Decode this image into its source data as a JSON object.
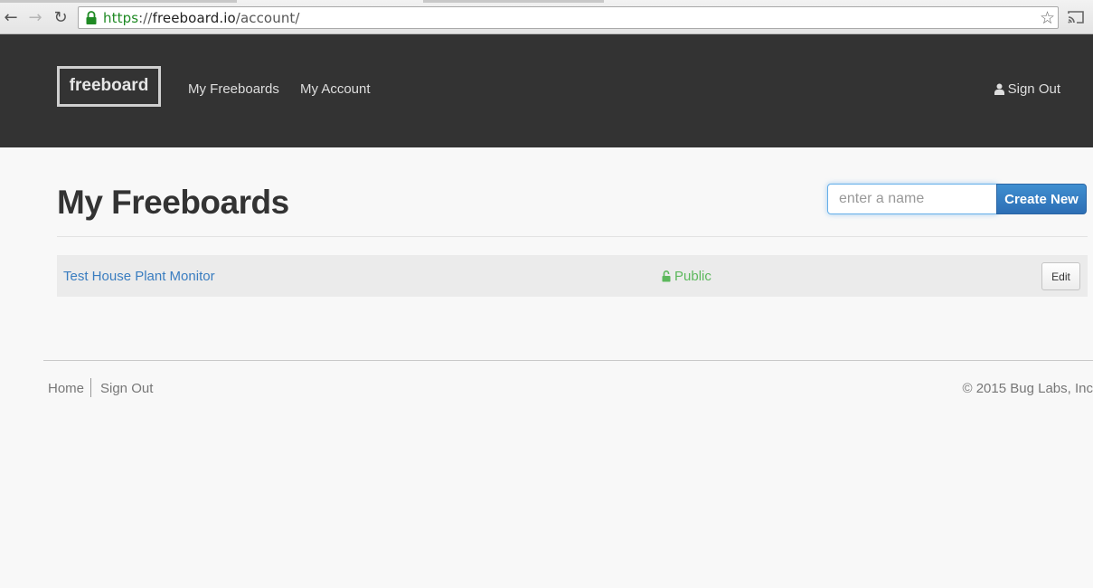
{
  "browser": {
    "url_scheme": "https",
    "url_separator": "://",
    "url_host": "freeboard.io",
    "url_path": "/account/",
    "back_icon": "back-arrow-icon",
    "forward_icon": "forward-arrow-icon",
    "reload_icon": "reload-icon",
    "bookmark_icon": "star-icon",
    "cast_icon": "cast-icon",
    "secure_color": "#1f8a24"
  },
  "header": {
    "brand": "freeboard",
    "nav": [
      {
        "label": "My Freeboards"
      },
      {
        "label": "My Account"
      }
    ],
    "sign_out": "Sign Out",
    "background": "#333333"
  },
  "main": {
    "title": "My Freeboards",
    "name_input": {
      "value": "",
      "placeholder": "enter a name"
    },
    "create_button": "Create New",
    "boards": [
      {
        "name": "Test House Plant Monitor",
        "visibility": "Public",
        "edit_label": "Edit"
      }
    ],
    "accent_color": "#3a7dc0",
    "public_color": "#5cb85c"
  },
  "footer": {
    "links": [
      {
        "label": "Home"
      },
      {
        "label": "Sign Out"
      }
    ],
    "copyright": "© 2015 Bug Labs, Inc"
  }
}
